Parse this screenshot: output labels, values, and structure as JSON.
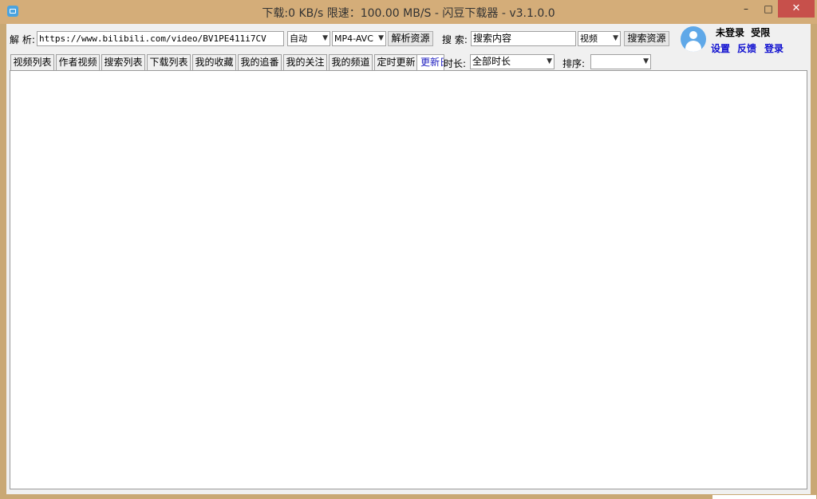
{
  "window": {
    "title": "下载:0 KB/s  限速：100.00 MB/S  - 闪豆下载器 - v3.1.0.0",
    "minimize": "–",
    "maximize": "□",
    "close": "✕"
  },
  "parse": {
    "label": "解 析:",
    "url_value": "https://www.bilibili.com/video/BV1PE411i7CV",
    "quality": "自动",
    "format": "MP4-AVC",
    "button": "解析资源"
  },
  "search": {
    "label": "搜 索:",
    "placeholder": "搜索内容",
    "type": "视频",
    "button": "搜索资源"
  },
  "user": {
    "status": "未登录",
    "limit": "受限",
    "links": [
      "设置",
      "反馈",
      "登录"
    ]
  },
  "tabs": [
    {
      "label": "视频列表"
    },
    {
      "label": "作者视频"
    },
    {
      "label": "搜索列表"
    },
    {
      "label": "下载列表"
    },
    {
      "label": "我的收藏"
    },
    {
      "label": "我的追番"
    },
    {
      "label": "我的关注"
    },
    {
      "label": "我的频道"
    },
    {
      "label": "定时更新"
    },
    {
      "label": "更新日志",
      "active": true
    }
  ],
  "filters": {
    "duration_label": "时长:",
    "duration_value": "全部时长",
    "sort_label": "排序:",
    "sort_value": ""
  },
  "colors": {
    "titlebar": "#d4ad79",
    "close_button": "#c7504b",
    "link": "#1010d0"
  }
}
